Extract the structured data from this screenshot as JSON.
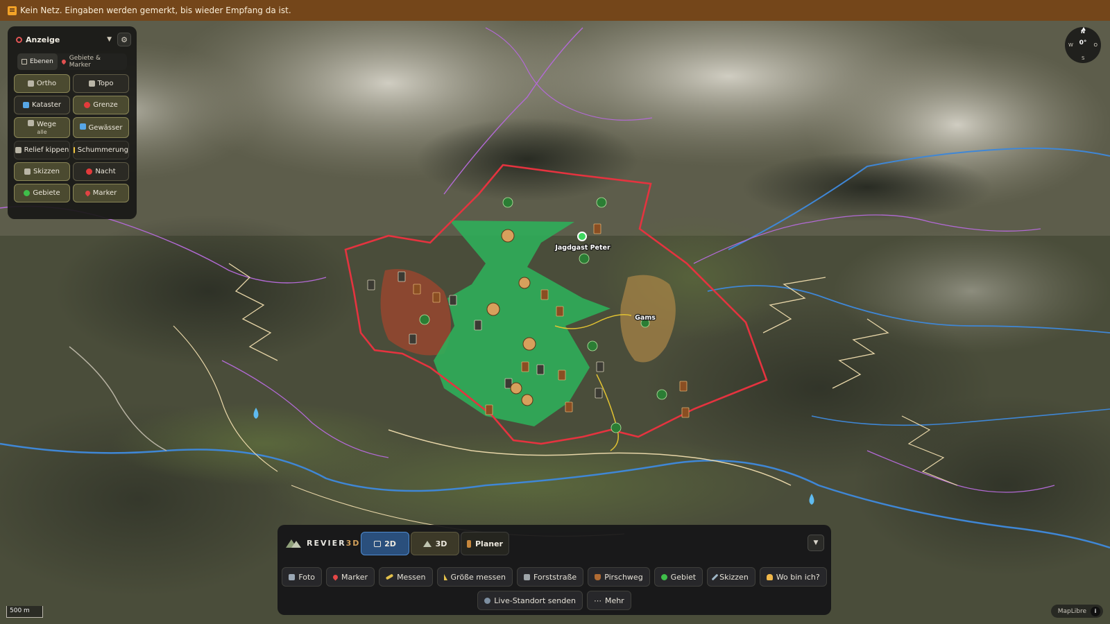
{
  "banner": {
    "icon": "warning-icon",
    "text": "Kein Netz. Eingaben werden gemerkt, bis wieder Empfang da ist."
  },
  "panel": {
    "title": "Anzeige",
    "tabs": [
      {
        "label": "Ebenen",
        "active": true
      },
      {
        "label": "Gebiete & Marker",
        "active": false
      }
    ],
    "buttons": {
      "ortho": "Ortho",
      "topo": "Topo",
      "kataster": "Kataster",
      "grenze": "Grenze",
      "wege": "Wege",
      "wege_sub": "alle",
      "gewaesser": "Gewässer",
      "relief": "Relief kippen",
      "schummerung": "Schummerung",
      "skizzen": "Skizzen",
      "nacht": "Nacht",
      "gebiete": "Gebiete",
      "marker": "Marker"
    }
  },
  "compass": {
    "n": "N",
    "s": "S",
    "w": "W",
    "o": "O",
    "heading": "0°"
  },
  "map": {
    "labels": {
      "guest": "Jagdgast Peter",
      "gams": "Gams"
    },
    "colors": {
      "boundary": "#e5333f",
      "hunting_area": "#2fae5a",
      "red_zone": "#a2462e",
      "orange_zone": "#b48a48",
      "trail": "#e8d6a8",
      "river": "#3f87d6",
      "path_purple": "#b36ad6"
    }
  },
  "toolbar": {
    "brand": "REVIER",
    "brand_accent": "3D",
    "views": {
      "two_d": "2D",
      "three_d": "3D",
      "planer": "Planer"
    },
    "row1": [
      "Foto",
      "Marker",
      "Messen",
      "Größe messen",
      "Forststraße",
      "Pirschweg",
      "Gebiet",
      "Skizzen",
      "Wo bin ich?"
    ],
    "row2": [
      "Live-Standort senden",
      "Mehr"
    ]
  },
  "scale": "500 m",
  "attribution": "MapLibre"
}
